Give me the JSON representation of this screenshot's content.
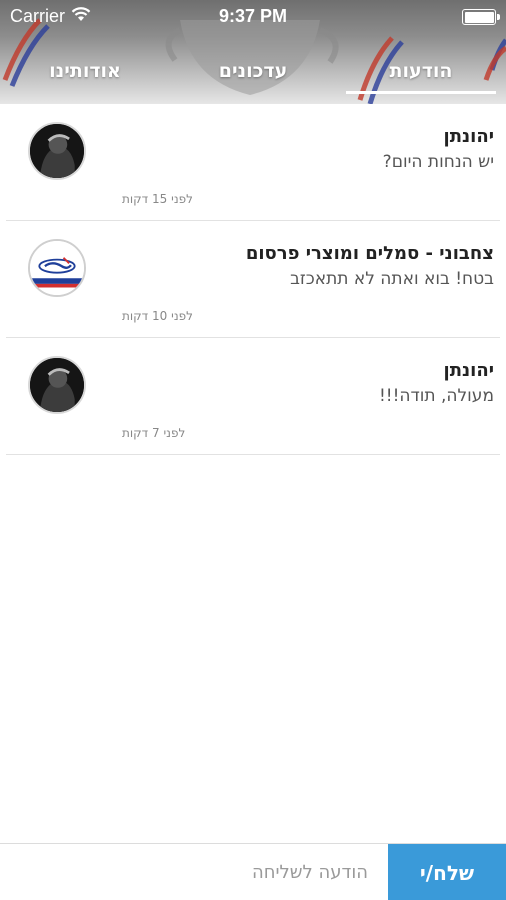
{
  "status_bar": {
    "carrier": "Carrier",
    "time": "9:37 PM"
  },
  "tabs": [
    {
      "label": "הודעות",
      "active": true
    },
    {
      "label": "עדכונים",
      "active": false
    },
    {
      "label": "אודותינו",
      "active": false
    }
  ],
  "messages": [
    {
      "name": "יהונתן",
      "text": "יש הנחות היום?",
      "time": "לפני 15 דקות",
      "avatar": "person-photo"
    },
    {
      "name": "צחבוני - סמלים ומוצרי פרסום",
      "text": "בטח! בוא ואתה לא תתאכזב",
      "time": "לפני 10 דקות",
      "avatar": "company-logo"
    },
    {
      "name": "יהונתן",
      "text": "מעולה, תודה!!!",
      "time": "לפני 7 דקות",
      "avatar": "person-photo"
    }
  ],
  "composer": {
    "placeholder": "הודעה לשליחה",
    "send_label": "שלח/י"
  },
  "colors": {
    "accent": "#3a9ad9",
    "tab_text": "#ffffff"
  }
}
